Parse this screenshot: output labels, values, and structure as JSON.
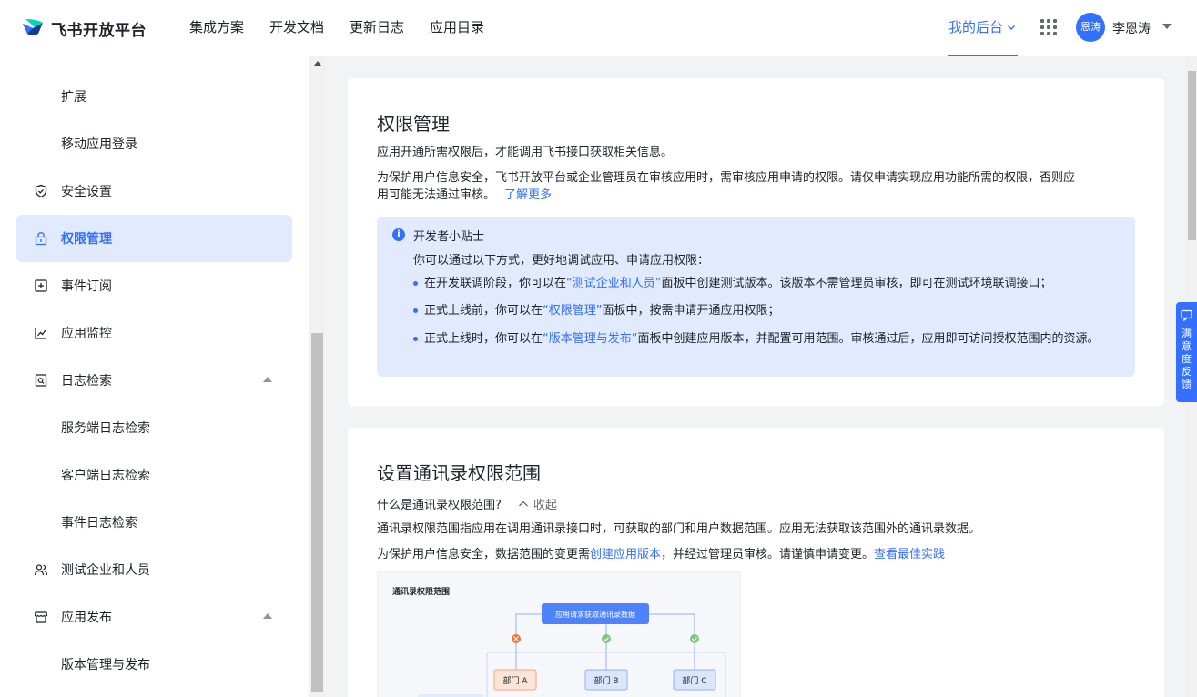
{
  "header": {
    "brand": "飞书开放平台",
    "nav": [
      "集成方案",
      "开发文档",
      "更新日志",
      "应用目录"
    ],
    "my_console": "我的后台",
    "avatar_text": "恩涛",
    "username": "李恩涛"
  },
  "sidebar": {
    "items": [
      {
        "label": "扩展"
      },
      {
        "label": "移动应用登录"
      },
      {
        "label": "安全设置"
      },
      {
        "label": "权限管理"
      },
      {
        "label": "事件订阅"
      },
      {
        "label": "应用监控"
      },
      {
        "label": "日志检索"
      },
      {
        "label": "服务端日志检索"
      },
      {
        "label": "客户端日志检索"
      },
      {
        "label": "事件日志检索"
      },
      {
        "label": "测试企业和人员"
      },
      {
        "label": "应用发布"
      },
      {
        "label": "版本管理与发布"
      }
    ],
    "active": "权限管理"
  },
  "permission": {
    "title": "权限管理",
    "desc1": "应用开通所需权限后，才能调用飞书接口获取相关信息。",
    "desc2_a": "为保护用户信息安全，飞书开放平台或企业管理员在审核应用时，需审核应用申请的权限。请仅申请实现应用功能所需的权限，否则应",
    "desc2_b": "用可能无法通过审核。",
    "learn_more": "了解更多",
    "tip": {
      "title": "开发者小贴士",
      "subtitle": "你可以通过以下方式，更好地调试应用、申请应用权限：",
      "b1_pre": "在开发联调阶段，你可以在",
      "b1_link": "“测试企业和人员”",
      "b1_post": "面板中创建测试版本。该版本不需管理员审核，即可在测试环境联调接口；",
      "b2_pre": "正式上线前，你可以在",
      "b2_link": "“权限管理”",
      "b2_post": "面板中，按需申请开通应用权限；",
      "b3_pre": "正式上线时，你可以在",
      "b3_link": "“版本管理与发布”",
      "b3_post": "面板中创建应用版本，并配置可用范围。审核通过后，应用即可访问授权范围内的资源。"
    }
  },
  "contacts": {
    "title": "设置通讯录权限范围",
    "question": "什么是通讯录权限范围?",
    "collapse": "收起",
    "desc1": "通讯录权限范围指应用在调用通讯录接口时，可获取的部门和用户数据范围。应用无法获取该范围外的通讯录数据。",
    "desc2_pre": "为保护用户信息安全，数据范围的变更需",
    "desc2_link1": "创建应用版本",
    "desc2_mid": "，并经过管理员审核。请谨慎申请变更。",
    "desc2_link2": "查看最佳实践",
    "diagram": {
      "title": "通讯录权限范围",
      "top_box": "应用请求获取通讯录数据",
      "dept_a": "部门 A",
      "dept_b": "部门 B",
      "dept_c": "部门 C"
    }
  },
  "feedback": {
    "label": "满意度反馈"
  },
  "colors": {
    "accent": "#3370ff",
    "tip_bg": "#e1eaff",
    "active_bg": "#e1eaff"
  }
}
